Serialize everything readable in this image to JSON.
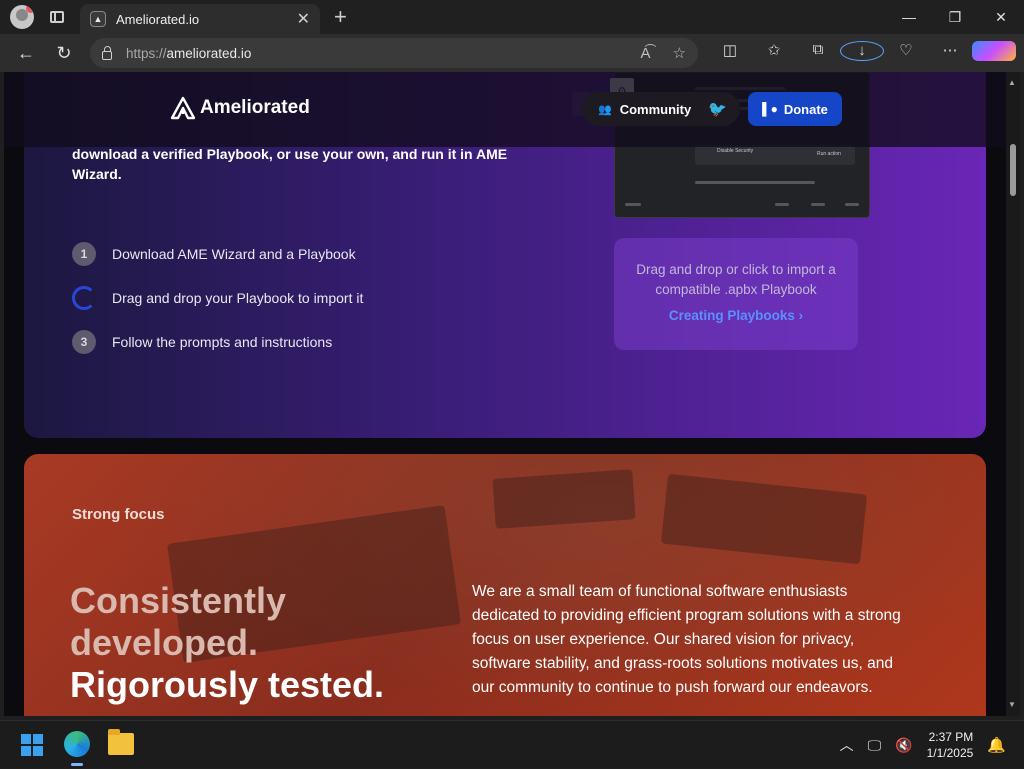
{
  "browser": {
    "tab_title": "Ameliorated.io",
    "tab_close": "✕",
    "new_tab": "+",
    "url_protocol": "https://",
    "url_host": "ameliorated.io",
    "window_controls": [
      "—",
      "❐",
      "✕"
    ]
  },
  "site": {
    "brand": "Ameliorated",
    "community_label": "Community",
    "donate_label": "Donate"
  },
  "hero": {
    "lead": "download a verified Playbook, or use your own, and run it in AME Wizard.",
    "steps": [
      {
        "num": "1",
        "label": "Download AME Wizard and a Playbook"
      },
      {
        "num": "",
        "label": "Drag and drop your Playbook to import it"
      },
      {
        "num": "3",
        "label": "Follow the prompts and instructions"
      }
    ],
    "preview_setting_label": "Disable Security",
    "preview_setting_button": "Run action",
    "dropzone_text": "Drag and drop or click to import a compatible .apbx Playbook",
    "dropzone_link": "Creating Playbooks"
  },
  "about": {
    "section_label": "Strong focus",
    "headline_dim_1": "Consistently",
    "headline_dim_2": "developed.",
    "headline_bright": "Rigorously tested.",
    "body": "We are a small team of functional software enthusiasts dedicated to providing efficient program solutions with a strong focus on user experience. Our shared vision for privacy, software stability, and grass-roots solutions motivates us, and our community to continue to push forward our endeavors."
  },
  "taskbar": {
    "time": "2:37 PM",
    "date": "1/1/2025"
  },
  "colors": {
    "accent_blue": "#1646c8",
    "link_blue": "#5a90ff",
    "purple": "#6a26b6",
    "red": "#a83a24"
  }
}
